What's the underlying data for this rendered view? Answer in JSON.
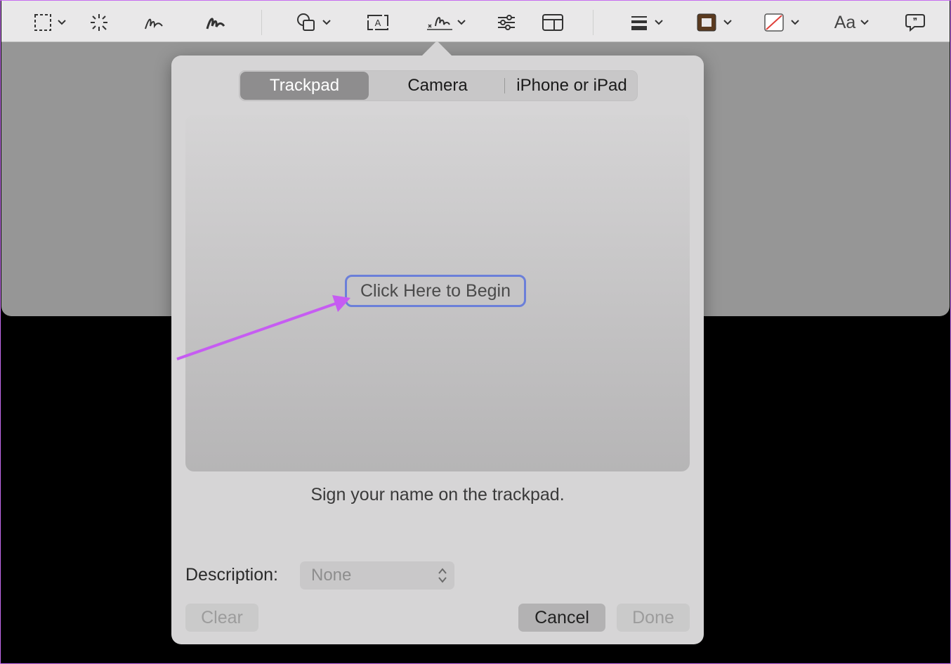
{
  "toolbar": {
    "icons": [
      "selection-icon",
      "chevron-down-icon",
      "instant-alpha-icon",
      "sketch-icon",
      "draw-icon",
      "shapes-icon",
      "text-box-icon",
      "signature-icon",
      "adjust-color-icon",
      "page-layout-icon",
      "line-style-icon",
      "border-color-icon",
      "fill-color-icon",
      "text-style-icon",
      "speech-bubble-icon"
    ],
    "text_style_label": "Aa",
    "border_color": "#5a3a1f",
    "fill_color": "#e0403a"
  },
  "signature_panel": {
    "tabs": [
      "Trackpad",
      "Camera",
      "iPhone or iPad"
    ],
    "active_tab": "Trackpad",
    "begin_label": "Click Here to Begin",
    "hint": "Sign your name on the trackpad.",
    "description_label": "Description:",
    "description_value": "None",
    "clear_label": "Clear",
    "cancel_label": "Cancel",
    "done_label": "Done"
  },
  "colors": {
    "highlight_border": "#6b7fd9",
    "annotation_arrow": "#c65cf2"
  }
}
